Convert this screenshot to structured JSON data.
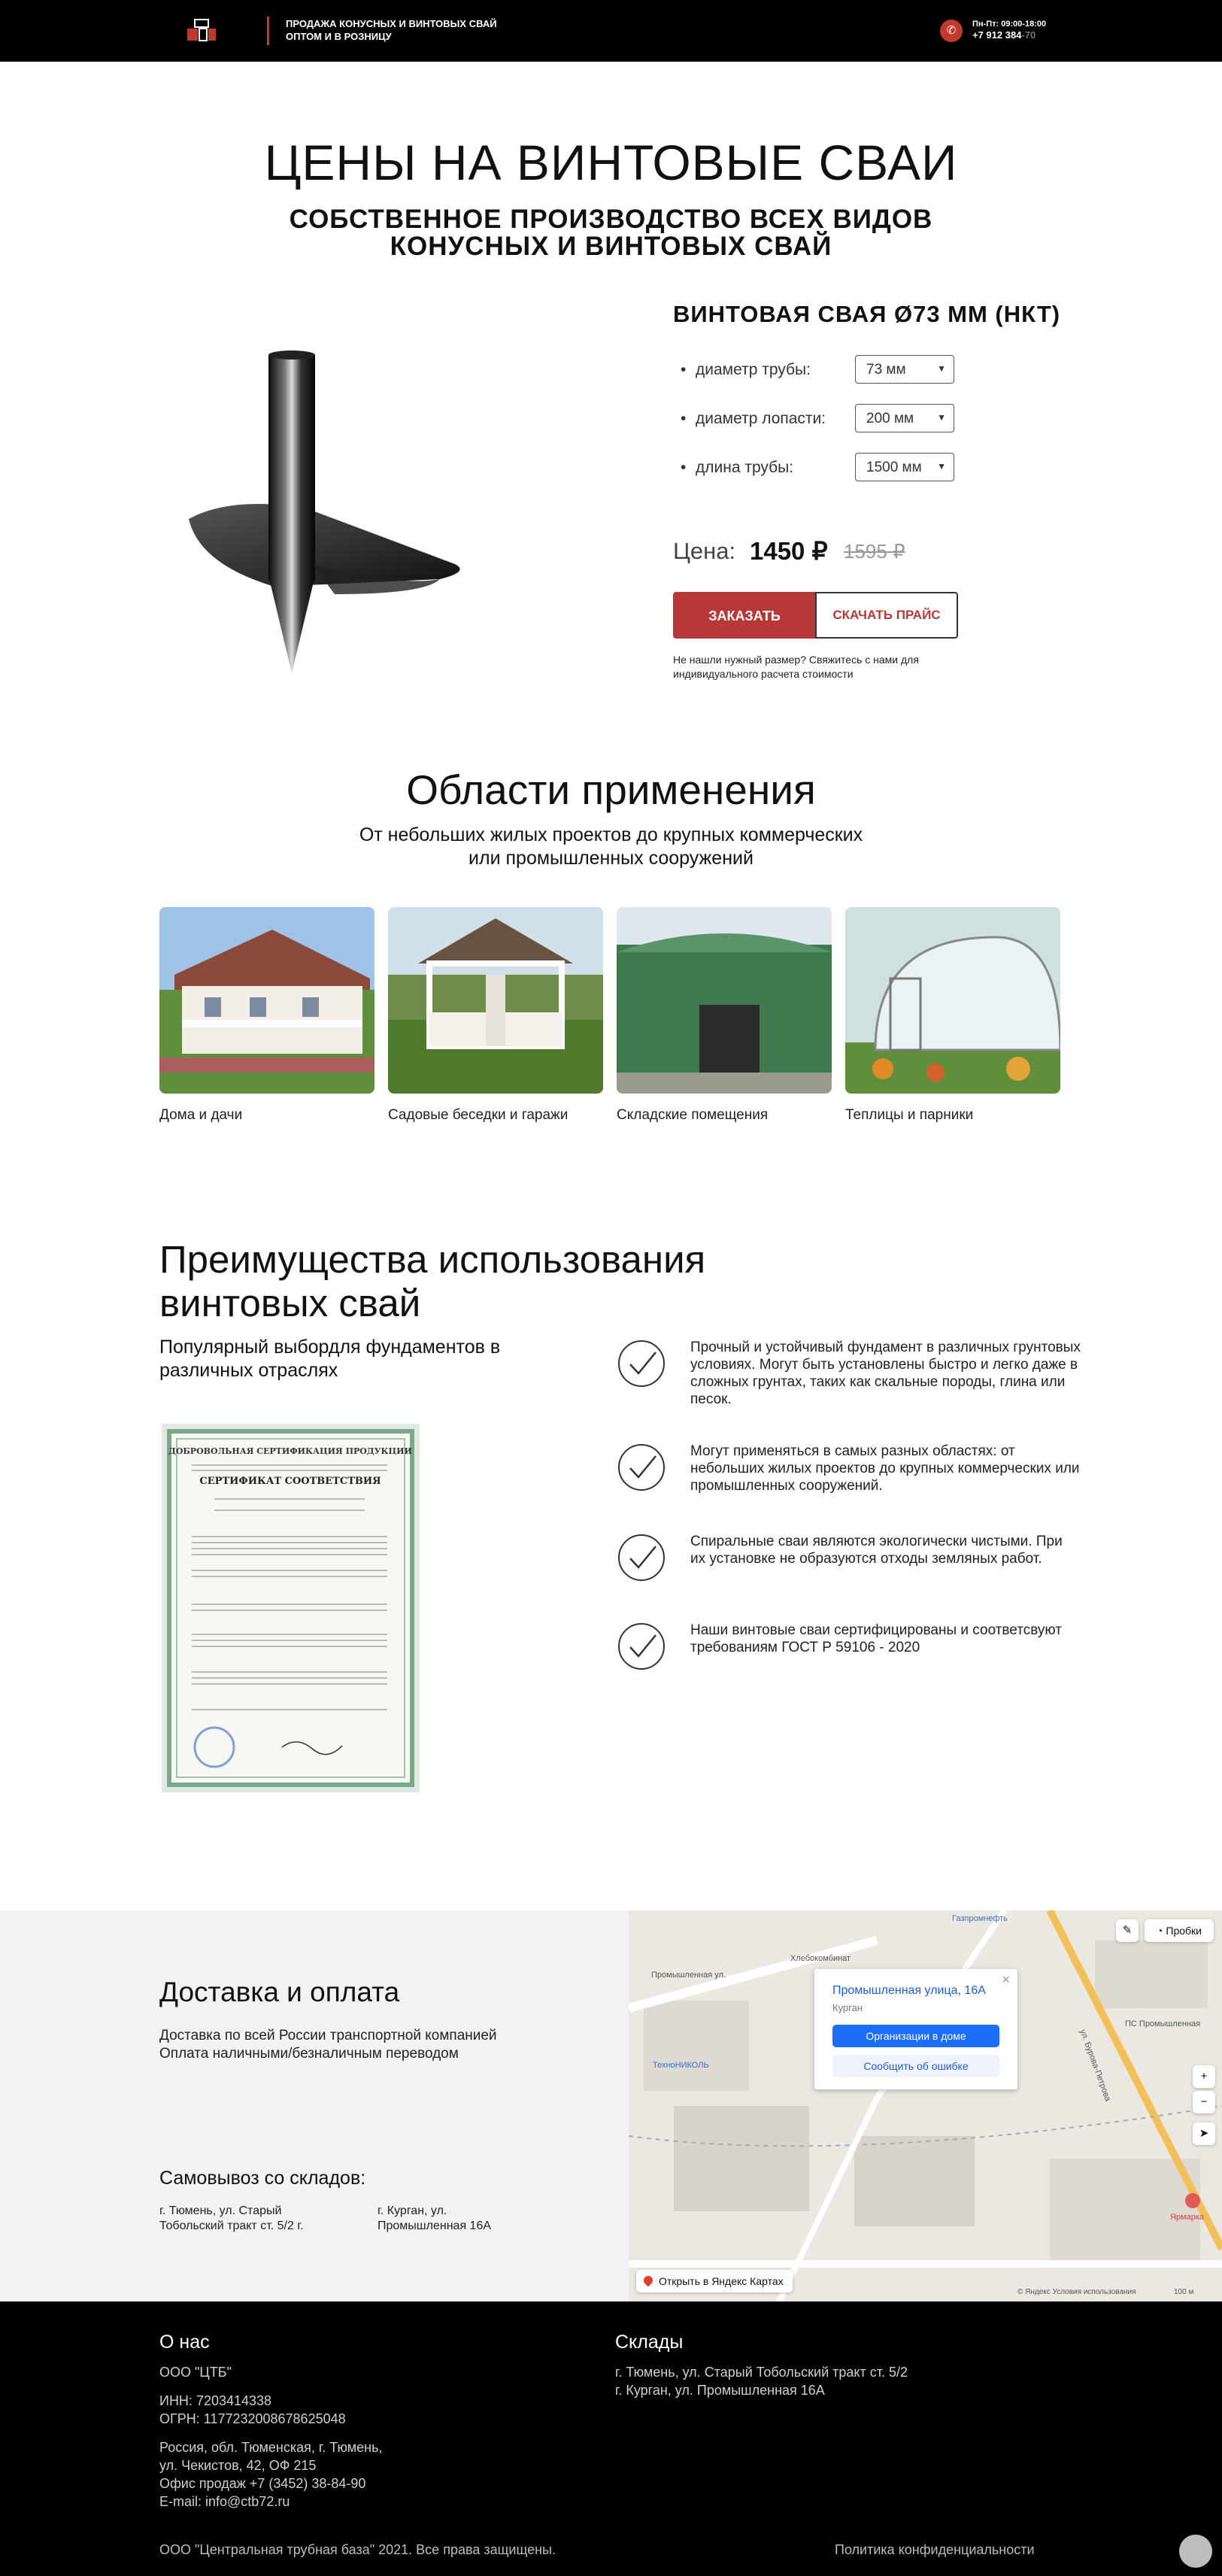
{
  "header": {
    "tagline_line1": "ПРОДАЖА КОНУСНЫХ И ВИНТОВЫХ СВАЙ",
    "tagline_line2": "ОПТОМ И В РОЗНИЦУ",
    "hours": "Пн-Пт: 09:00-18:00",
    "phone_main": "+7 912 384",
    "phone_tail": "-70"
  },
  "hero": {
    "title": "ЦЕНЫ НА ВИНТОВЫЕ СВАИ",
    "subtitle_line1": "СОБСТВЕННОЕ ПРОИЗВОДСТВО ВСЕХ ВИДОВ",
    "subtitle_line2": "КОНУСНЫХ И ВИНТОВЫХ СВАЙ"
  },
  "product": {
    "name": "ВИНТОВАЯ СВАЯ Ø73 ММ (НКТ)",
    "options": [
      {
        "label": "диаметр трубы:",
        "value": "73 мм"
      },
      {
        "label": "диаметр лопасти:",
        "value": "200 мм"
      },
      {
        "label": "длина трубы:",
        "value": "1500 мм"
      }
    ],
    "price_label": "Цена:",
    "price": "1450 ₽",
    "old_price": "1595 ₽",
    "order_button": "ЗАКАЗАТЬ",
    "download_button": "СКАЧАТЬ ПРАЙС",
    "note": "Не нашли нужный размер? Свяжитесь с нами для индивидуального расчета стоимости"
  },
  "areas": {
    "title": "Области применения",
    "subtitle_line1": "От небольших жилых проектов до крупных коммерческих",
    "subtitle_line2": "или промышленных сооружений",
    "cards": [
      {
        "caption": "Дома и дачи"
      },
      {
        "caption": "Садовые беседки и гаражи"
      },
      {
        "caption": "Складские помещения"
      },
      {
        "caption": "Теплицы и парники"
      }
    ]
  },
  "advantages": {
    "title_line1": "Преимущества использования",
    "title_line2": "винтовых свай",
    "subtitle": "Популярный выбордля фундаментов в различных отраслях",
    "cert_heading": "ДОБРОВОЛЬНАЯ СЕРТИФИКАЦИЯ ПРОДУКЦИИ",
    "cert_title": "СЕРТИФИКАТ СООТВЕТСТВИЯ",
    "items": [
      "Прочный и устойчивый фундамент в различных грунтовых условиях. Могут быть установлены быстро и легко даже в сложных грунтах, таких как скальные породы, глина или песок.",
      "Могут применяться в самых разных областях: от небольших жилых проектов до крупных коммерческих или промышленных сооружений.",
      "Спиральные сваи являются экологически чистыми. При их установке не образуются отходы земляных работ.",
      "Наши винтовые сваи сертифицированы и соответсвуют требованиям ГОСТ Р 59106 - 2020"
    ]
  },
  "delivery": {
    "title": "Доставка и оплата",
    "line1": "Доставка по всей России транспортной компанией",
    "line2": "Оплата наличными/безналичным переводом",
    "pickup_title": "Самовывоз со складов:",
    "pickup1_line1": "г. Тюмень, ул. Старый",
    "pickup1_line2": "Тобольский тракт ст. 5/2 г.",
    "pickup2_line1": "г. Курган, ул.",
    "pickup2_line2": "Промышленная 16А"
  },
  "map": {
    "popup_address": "Промышленная улица, 16А",
    "popup_city": "Курган",
    "popup_btn1": "Организации в доме",
    "popup_btn2": "Сообщить об ошибке",
    "traffic": "Пробки",
    "open_link": "Открыть в Яндекс Картах",
    "copyright": "© Яндекс  Условия использования",
    "scale": "100 м",
    "street1": "Промышленная ул.",
    "street2": "ул. Бурова-Петрова",
    "poi1": "Газпромнефть",
    "poi2": "Хлебокомбинат",
    "poi3": "ТехноНИКОЛЬ",
    "poi4": "ПС Промышленная",
    "poi5": "Ярмарка"
  },
  "footer": {
    "about_title": "О нас",
    "company": "ООО \"ЦТБ\"",
    "inn": "ИНН: 7203414338",
    "ogrn": "ОГРН: 1177232008678625048",
    "addr1": "Россия, обл. Тюменская, г. Тюмень,",
    "addr2": "ул. Чекистов, 42, ОФ 215",
    "office": "Офис продаж +7 (3452) 38-84-90",
    "email": "E-mail: info@ctb72.ru",
    "warehouses_title": "Склады",
    "wh1": "г. Тюмень, ул. Старый Тобольский тракт ст. 5/2",
    "wh2": "г. Курган, ул. Промышленная 16А",
    "copyright": "ООО \"Центральная трубная база\" 2021. Все права защищены.",
    "privacy": "Политика конфиденциальности"
  }
}
